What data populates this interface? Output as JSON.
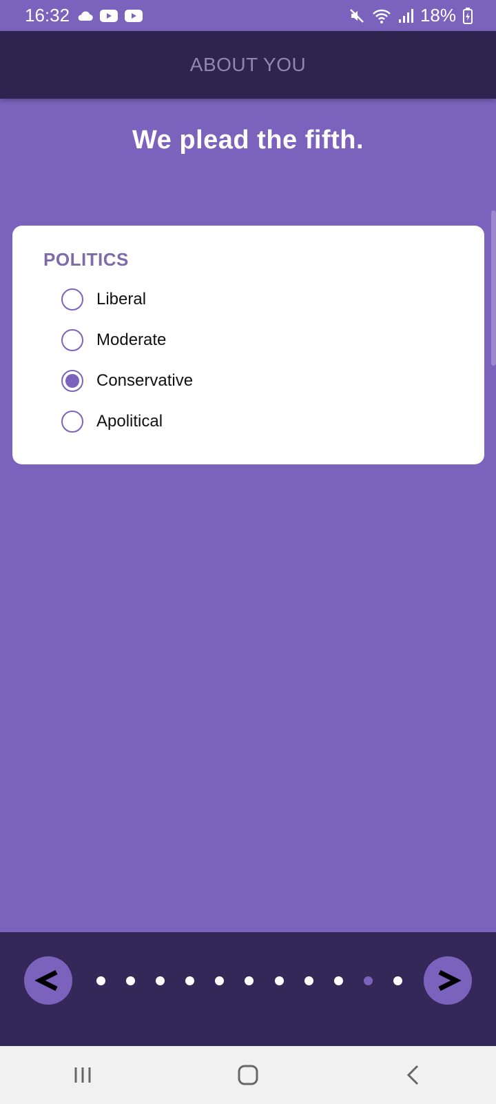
{
  "status_bar": {
    "time": "16:32",
    "battery": "18%"
  },
  "header": {
    "title": "ABOUT YOU"
  },
  "main": {
    "heading": "We plead the fifth.",
    "section_label": "POLITICS",
    "options": [
      {
        "label": "Liberal",
        "selected": false
      },
      {
        "label": "Moderate",
        "selected": false
      },
      {
        "label": "Conservative",
        "selected": true
      },
      {
        "label": "Apolitical",
        "selected": false
      }
    ]
  },
  "pager": {
    "total_steps": 11,
    "active_step": 10
  },
  "colors": {
    "brand_purple": "#7b63bd",
    "header_dark": "#2e2450",
    "pager_dark": "#332857",
    "label_purple": "#7e6ba8"
  },
  "icons": {
    "status_left": [
      "cloud-icon",
      "youtube-icon",
      "youtube-icon"
    ],
    "status_right": [
      "mute-icon",
      "wifi-icon",
      "signal-icon",
      "battery-charging-icon"
    ],
    "system_nav": [
      "recent-apps-icon",
      "home-icon",
      "back-icon"
    ]
  }
}
